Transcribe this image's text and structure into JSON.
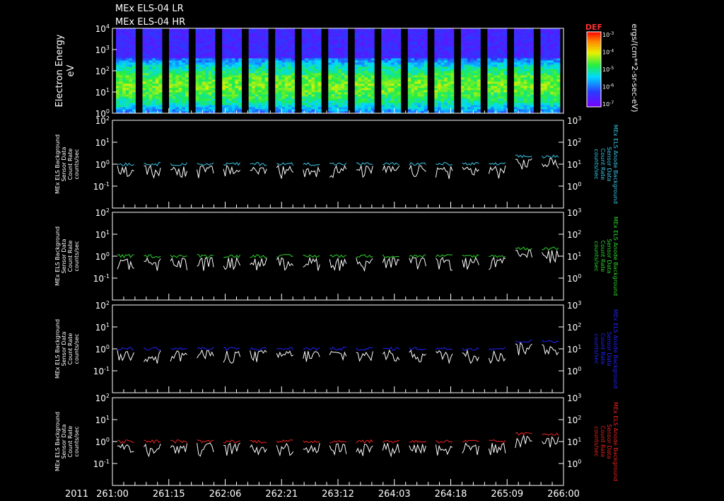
{
  "titles": [
    "MEx ELS-04 LR",
    "MEx ELS-04 HR"
  ],
  "year_label": "2011",
  "time_ticks": [
    "261:00",
    "261:15",
    "262:06",
    "262:21",
    "263:12",
    "264:03",
    "264:18",
    "265:09",
    "266:00"
  ],
  "spectrogram": {
    "ylabel_line1": "Electron Energy",
    "ylabel_line2": "eV",
    "colorbar_title": "DEF",
    "colorbar_unit": "ergs/(cm**2-sr-sec-eV)"
  },
  "panels": [
    {
      "left_label": [
        "MEx ELS Background",
        "Sensor Data",
        "Count Rate",
        "counts/sec"
      ],
      "right_label": [
        "MEx ELS Anode Background",
        "Sensor Data",
        "Count Rate",
        "counts/sec"
      ],
      "color": "#39c5e6"
    },
    {
      "left_label": [
        "MEx ELS Background",
        "Sensor Data",
        "Count Rate",
        "counts/sec"
      ],
      "right_label": [
        "MEx ELS Anode Background",
        "Sensor Data",
        "Count Rate",
        "counts/sec"
      ],
      "color": "#2bd62b"
    },
    {
      "left_label": [
        "MEx ELS Background",
        "Sensor Data",
        "Count Rate",
        "counts/sec"
      ],
      "right_label": [
        "MEx ELS Anode Background",
        "Sensor Data",
        "Count Rate",
        "counts/sec"
      ],
      "color": "#2222ff"
    },
    {
      "left_label": [
        "MEx ELS Background",
        "Sensor Data",
        "Count Rate",
        "counts/sec"
      ],
      "right_label": [
        "MEx ELS Anode Background",
        "Sensor Data",
        "Count Rate",
        "counts/sec"
      ],
      "color": "#ee2222"
    }
  ],
  "chart_data": {
    "type": "line",
    "x_range": [
      "261:00",
      "266:00"
    ],
    "spectrogram": {
      "type": "heatmap",
      "y_range_eV": [
        1,
        10000
      ],
      "y_scale": "log",
      "y_ticks": [
        "10^0",
        "10^1",
        "10^2",
        "10^3",
        "10^4"
      ],
      "colorbar_range": [
        1e-07,
        0.001
      ],
      "colorbar_ticks": [
        "10^-3",
        "10^-4",
        "10^-5",
        "10^-6",
        "10^-7"
      ],
      "data_segments": 17,
      "peak_energy_eV": 20
    },
    "count_rate_panels": [
      {
        "series_color": "#39c5e6",
        "left_ylim": [
          0.01,
          100
        ],
        "right_ylim": [
          0.1,
          1000
        ],
        "left_ticks": [
          "10^-1",
          "10^0",
          "10^1",
          "10^2"
        ],
        "right_ticks": [
          "10^0",
          "10^1",
          "10^2",
          "10^3"
        ],
        "series_level": 10,
        "white_level": 0.6
      },
      {
        "series_color": "#2bd62b",
        "left_ylim": [
          0.01,
          100
        ],
        "right_ylim": [
          0.1,
          1000
        ],
        "left_ticks": [
          "10^-1",
          "10^0",
          "10^1",
          "10^2"
        ],
        "right_ticks": [
          "10^0",
          "10^1",
          "10^2",
          "10^3"
        ],
        "series_level": 10,
        "white_level": 0.6
      },
      {
        "series_color": "#2222ff",
        "left_ylim": [
          0.01,
          100
        ],
        "right_ylim": [
          0.1,
          1000
        ],
        "left_ticks": [
          "10^-1",
          "10^0",
          "10^1",
          "10^2"
        ],
        "right_ticks": [
          "10^0",
          "10^1",
          "10^2",
          "10^3"
        ],
        "series_level": 10,
        "white_level": 0.6
      },
      {
        "series_color": "#ee2222",
        "left_ylim": [
          0.01,
          100
        ],
        "right_ylim": [
          0.1,
          1000
        ],
        "left_ticks": [
          "10^-1",
          "10^0",
          "10^1",
          "10^2"
        ],
        "right_ticks": [
          "10^0",
          "10^1",
          "10^2",
          "10^3"
        ],
        "series_level": 10,
        "white_level": 0.6
      }
    ]
  }
}
